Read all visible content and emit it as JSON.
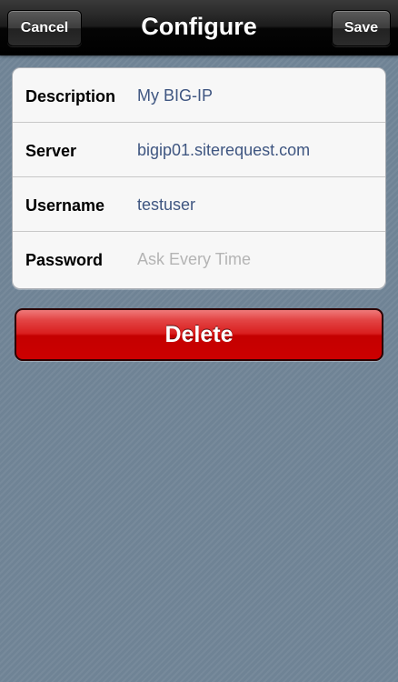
{
  "navbar": {
    "title": "Configure",
    "cancel_label": "Cancel",
    "save_label": "Save"
  },
  "form": {
    "description": {
      "label": "Description",
      "value": "My BIG-IP"
    },
    "server": {
      "label": "Server",
      "value": "bigip01.siterequest.com"
    },
    "username": {
      "label": "Username",
      "value": "testuser"
    },
    "password": {
      "label": "Password",
      "placeholder": "Ask Every Time"
    }
  },
  "delete_label": "Delete",
  "colors": {
    "value_text": "#3f5681",
    "delete_red": "#cc0000",
    "background": "#6f8395"
  }
}
